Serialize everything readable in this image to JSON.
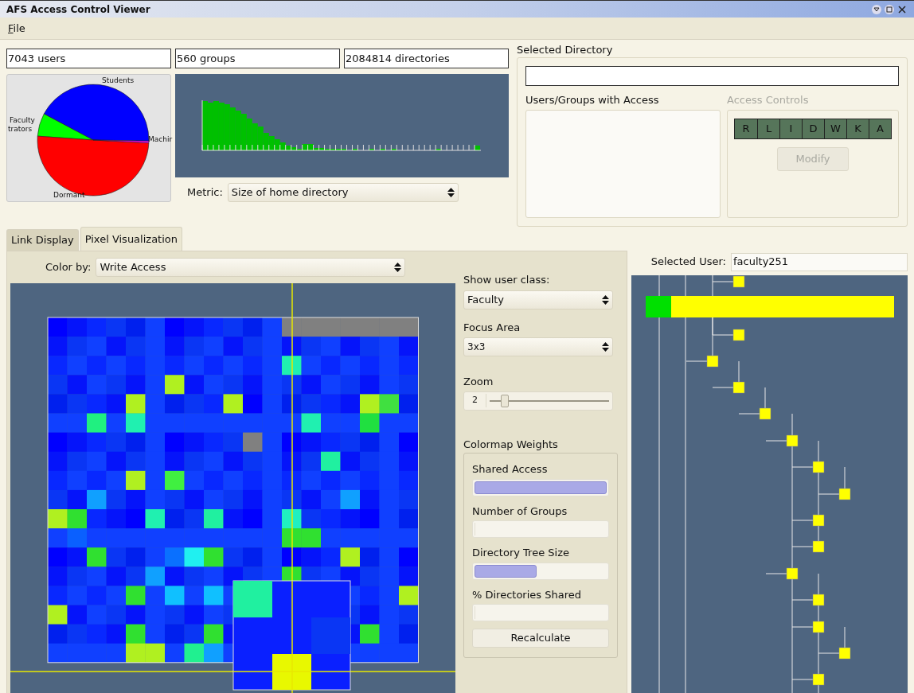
{
  "window": {
    "title": "AFS Access Control Viewer"
  },
  "menu": [
    {
      "label": "File"
    }
  ],
  "stats": [
    "7043 users",
    "560 groups",
    "2084814 directories"
  ],
  "pie": {
    "labels": [
      "Students",
      "Faculty",
      "trators",
      "Machir",
      "Dormant"
    ]
  },
  "metric": {
    "label": "Metric:",
    "value": "Size of home directory"
  },
  "selected_directory": {
    "title": "Selected Directory"
  },
  "access": {
    "users_title": "Users/Groups with Access",
    "controls_title": "Access Controls",
    "disabled": true,
    "rights": [
      "R",
      "L",
      "I",
      "D",
      "W",
      "K",
      "A"
    ],
    "modify": {
      "label": "Modify",
      "disabled": true
    }
  },
  "tabs": [
    {
      "label": "Link Display",
      "selected": false
    },
    {
      "label": "Pixel Visualization",
      "selected": true
    }
  ],
  "color_by": {
    "label": "Color by:",
    "value": "Write Access"
  },
  "user_class": {
    "label": "Show user class:",
    "value": "Faculty"
  },
  "focus_area": {
    "label": "Focus Area",
    "value": "3x3"
  },
  "zoom": {
    "label": "Zoom",
    "value": "2",
    "level": 0.1
  },
  "weights": {
    "title": "Colormap Weights",
    "items": [
      {
        "label": "Shared Access",
        "level": 1
      },
      {
        "label": "Number of Groups",
        "level": 0
      },
      {
        "label": "Directory Tree Size",
        "level": 0.47
      },
      {
        "label": "% Directories Shared",
        "level": 0
      }
    ],
    "button": "Recalculate"
  },
  "selected_user": {
    "label": "Selected User:",
    "value": "faculty251"
  }
}
